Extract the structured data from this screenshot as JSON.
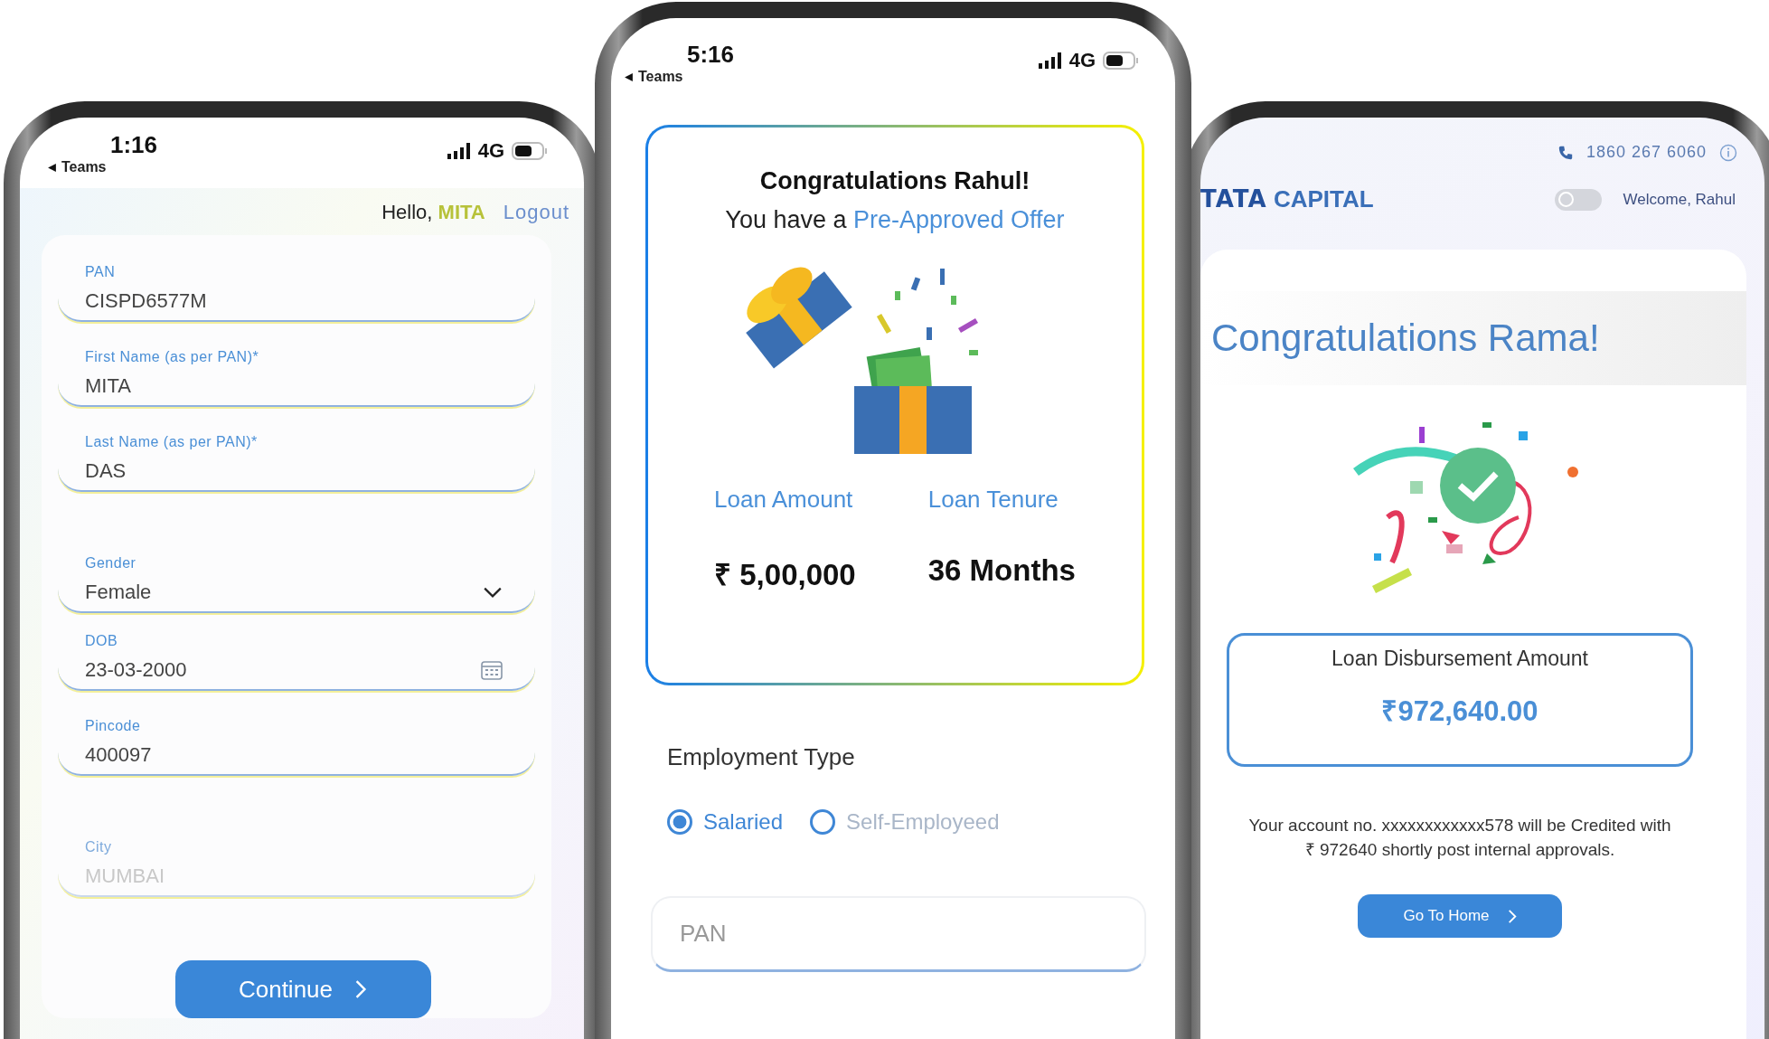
{
  "left_phone": {
    "status_bar": {
      "time": "1:16",
      "back_label": "Teams",
      "network": "4G"
    },
    "greeting": {
      "prefix": "Hello,",
      "name": "MITA",
      "logout": "Logout"
    },
    "fields": [
      {
        "label": "PAN",
        "value": "CISPD6577M",
        "kind": "text",
        "disabled": false
      },
      {
        "label": "First Name (as per PAN)*",
        "value": "MITA",
        "kind": "text",
        "disabled": false
      },
      {
        "label": "Last Name (as per PAN)*",
        "value": "DAS",
        "kind": "text",
        "disabled": false
      },
      {
        "label": "Gender",
        "value": "Female",
        "kind": "select",
        "disabled": false
      },
      {
        "label": "DOB",
        "value": "23-03-2000",
        "kind": "date",
        "disabled": false
      },
      {
        "label": "Pincode",
        "value": "400097",
        "kind": "text",
        "disabled": false
      },
      {
        "label": "City",
        "value": "MUMBAI",
        "kind": "text",
        "disabled": true
      }
    ],
    "button": "Continue"
  },
  "center_phone": {
    "status_bar": {
      "time": "5:16",
      "back_label": "Teams",
      "network": "4G"
    },
    "offer": {
      "title": "Congratulations Rahul!",
      "subtitle_prefix": "You have a",
      "subtitle_highlight": "Pre-Approved Offer",
      "metrics": [
        {
          "label": "Loan Amount",
          "value": "₹ 5,00,000"
        },
        {
          "label": "Loan Tenure",
          "value": "36 Months"
        }
      ]
    },
    "employment": {
      "title": "Employment Type",
      "options": [
        {
          "label": "Salaried",
          "selected": true
        },
        {
          "label": "Self-Employeed",
          "selected": false
        }
      ]
    },
    "pan_field": {
      "placeholder": "PAN"
    }
  },
  "right_phone": {
    "support_phone": "1860 267 6060",
    "logo": {
      "primary": "TATA",
      "secondary": "CAPITAL"
    },
    "toggle": {
      "on": false
    },
    "welcome": "Welcome, Rahul",
    "heading": "Congratulations Rama!",
    "amount_box": {
      "label": "Loan Disbursement Amount",
      "value": "₹972,640.00"
    },
    "message": "Your account no. xxxxxxxxxxxx578 will be Credited with ₹ 972640 shortly post internal approvals.",
    "button": "Go To Home"
  }
}
